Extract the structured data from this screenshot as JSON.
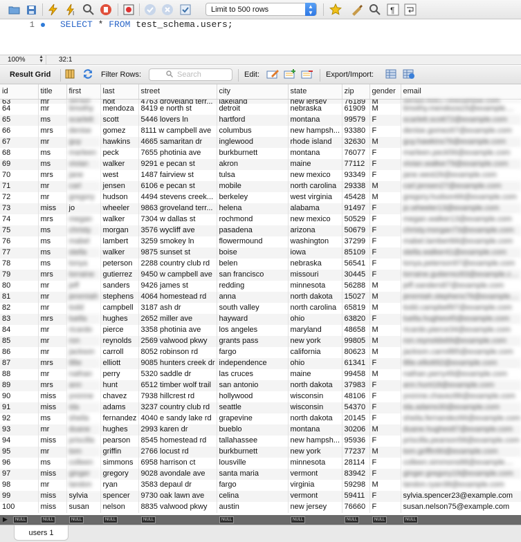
{
  "toolbar": {
    "limit_label": "Limit to 500 rows",
    "icons": [
      "open-folder-icon",
      "save-icon",
      "lightning-execute-icon",
      "lightning-execute-current-icon",
      "explain-magnifier-icon",
      "stop-icon",
      "toggle-error-icon",
      "commit-check-icon",
      "rollback-x-icon",
      "autocommit-icon",
      "bookmark-star-icon",
      "beautify-brush-icon",
      "find-icon",
      "invisible-chars-icon",
      "wrap-icon"
    ]
  },
  "editor": {
    "line_number": "1",
    "sql_select": "SELECT",
    "sql_star": " * ",
    "sql_from": "FROM",
    "sql_rest": " test_schema.users;"
  },
  "status": {
    "zoom": "100%",
    "cursor": "32:1"
  },
  "grid_toolbar": {
    "result_grid": "Result Grid",
    "filter_rows": "Filter Rows:",
    "search_placeholder": "Search",
    "edit": "Edit:",
    "export_import": "Export/Import:"
  },
  "columns": [
    "id",
    "title",
    "first",
    "last",
    "street",
    "city",
    "state",
    "zip",
    "gender",
    "email"
  ],
  "top_partial_row": [
    "63",
    "mr",
    "gerald",
    "holt",
    "4763 groveland terr...",
    "lakeland",
    "new jersey",
    "76189",
    "M",
    "gerald.holt17@example.com"
  ],
  "rows": [
    [
      "64",
      "mr",
      "timothy",
      "mendoza",
      "8419 e north st",
      "detroit",
      "nebraska",
      "61909",
      "M",
      "timothy.mendoza15@example...."
    ],
    [
      "65",
      "ms",
      "scarlett",
      "scott",
      "5446 lovers ln",
      "hartford",
      "montana",
      "99579",
      "F",
      "scarlett.scott72@example.com"
    ],
    [
      "66",
      "mrs",
      "denise",
      "gomez",
      "8111 w campbell ave",
      "columbus",
      "new hampsh...",
      "93380",
      "F",
      "denise.gomez67@example.com"
    ],
    [
      "67",
      "mr",
      "guy",
      "hawkins",
      "4665 samaritan dr",
      "inglewood",
      "rhode island",
      "32630",
      "M",
      "guy.hawkins76@example.com"
    ],
    [
      "68",
      "ms",
      "marleen",
      "peck",
      "7655 photinia ave",
      "burkburnett",
      "montana",
      "76077",
      "F",
      "marleen.peck56@example.com"
    ],
    [
      "69",
      "ms",
      "vivian",
      "walker",
      "9291 e pecan st",
      "akron",
      "maine",
      "77112",
      "F",
      "vivian.walker79@example.com"
    ],
    [
      "70",
      "mrs",
      "jane",
      "west",
      "1487 fairview st",
      "tulsa",
      "new mexico",
      "93349",
      "F",
      "jane.west26@example.com"
    ],
    [
      "71",
      "mr",
      "carl",
      "jensen",
      "6106 e pecan st",
      "mobile",
      "north carolina",
      "29338",
      "M",
      "carl.jensen27@example.com"
    ],
    [
      "72",
      "mr",
      "gregory",
      "hudson",
      "4494 stevens creek...",
      "berkeley",
      "west virginia",
      "45428",
      "M",
      "gregory.hudson66@example.com"
    ],
    [
      "73",
      "miss",
      "jo",
      "wheeler",
      "9863 groveland terr...",
      "helena",
      "alabama",
      "91497",
      "F",
      "jo.wheeler13@example.com"
    ],
    [
      "74",
      "mrs",
      "megan",
      "walker",
      "7304 w dallas st",
      "rochmond",
      "new mexico",
      "50529",
      "F",
      "megan.walker13@example.com"
    ],
    [
      "75",
      "ms",
      "christy",
      "morgan",
      "3576 wycliff ave",
      "pasadena",
      "arizona",
      "50679",
      "F",
      "christy.morgan73@example.com"
    ],
    [
      "76",
      "ms",
      "mabel",
      "lambert",
      "3259 smokey ln",
      "flowermound",
      "washington",
      "37299",
      "F",
      "mabel.lambert66@example.com"
    ],
    [
      "77",
      "ms",
      "stella",
      "walker",
      "9875 sunset st",
      "boise",
      "iowa",
      "85109",
      "F",
      "stella.walker41@example.com"
    ],
    [
      "78",
      "ms",
      "tonya",
      "peterson",
      "2288 country club rd",
      "belen",
      "nebraska",
      "56541",
      "F",
      "tonya.peterson97@example.com"
    ],
    [
      "79",
      "mrs",
      "lorraine",
      "gutierrez",
      "9450 w campbell ave",
      "san francisco",
      "missouri",
      "30445",
      "F",
      "lorraine.gutierrez83@example.com"
    ],
    [
      "80",
      "mr",
      "jeff",
      "sanders",
      "9426 james st",
      "redding",
      "minnesota",
      "56288",
      "M",
      "jeff.sanders87@example.com"
    ],
    [
      "81",
      "mr",
      "jeremiah",
      "stephens",
      "4064 homestead rd",
      "anna",
      "north dakota",
      "15027",
      "M",
      "jeremiah.stephens76@example...."
    ],
    [
      "82",
      "mr",
      "todd",
      "campbell",
      "3187 ash dr",
      "south valley",
      "north carolina",
      "65819",
      "M",
      "todd.campbell97@example.com"
    ],
    [
      "83",
      "mrs",
      "luella",
      "hughes",
      "2652 miller ave",
      "hayward",
      "ohio",
      "63820",
      "F",
      "luella.hughes45@example.com"
    ],
    [
      "84",
      "mr",
      "ricardo",
      "pierce",
      "3358 photinia ave",
      "los angeles",
      "maryland",
      "48658",
      "M",
      "ricardo.pierce34@example.com"
    ],
    [
      "85",
      "mr",
      "ron",
      "reynolds",
      "2569 valwood pkwy",
      "grants pass",
      "new york",
      "99805",
      "M",
      "ron.reynolds69@example.com"
    ],
    [
      "86",
      "mr",
      "jackson",
      "carroll",
      "8052 robinson rd",
      "fargo",
      "california",
      "80623",
      "M",
      "jackson.carroll85@example.com"
    ],
    [
      "87",
      "mrs",
      "lillie",
      "elliott",
      "9085 hunters creek dr",
      "independence",
      "ohio",
      "61341",
      "F",
      "lillie.elliott92@example.com"
    ],
    [
      "88",
      "mr",
      "nathan",
      "perry",
      "5320 saddle dr",
      "las cruces",
      "maine",
      "99458",
      "M",
      "nathan.perry49@example.com"
    ],
    [
      "89",
      "mrs",
      "ann",
      "hunt",
      "6512 timber wolf trail",
      "san antonio",
      "north dakota",
      "37983",
      "F",
      "ann.hunt18@example.com"
    ],
    [
      "90",
      "miss",
      "yvonne",
      "chavez",
      "7938 hillcrest rd",
      "hollywood",
      "wisconsin",
      "48106",
      "F",
      "yvonne.chavez86@example.com"
    ],
    [
      "91",
      "miss",
      "ida",
      "adams",
      "3237 country club rd",
      "seattle",
      "wisconsin",
      "54370",
      "F",
      "ida.adams30@example.com"
    ],
    [
      "92",
      "ms",
      "sheila",
      "fernandez",
      "4040 e sandy lake rd",
      "grapevine",
      "north dakota",
      "20145",
      "F",
      "sheila.fernandez66@example.com"
    ],
    [
      "93",
      "mr",
      "duane",
      "hughes",
      "2993 karen dr",
      "bueblo",
      "montana",
      "30206",
      "M",
      "duane.hughes87@example.com"
    ],
    [
      "94",
      "miss",
      "priscilla",
      "pearson",
      "8545 homestead rd",
      "tallahassee",
      "new hampsh...",
      "95936",
      "F",
      "priscilla.pearson58@example.com"
    ],
    [
      "95",
      "mr",
      "tom",
      "griffin",
      "2766 locust rd",
      "burkburnett",
      "new york",
      "77237",
      "M",
      "tom.griffin90@example.com"
    ],
    [
      "96",
      "ms",
      "colleen",
      "simmons",
      "6958 harrison ct",
      "lousville",
      "minnesota",
      "28114",
      "F",
      "colleen.simmons88@example...."
    ],
    [
      "97",
      "miss",
      "ginger",
      "gregory",
      "9028 avondale ave",
      "santa maria",
      "vermont",
      "83942",
      "F",
      "ginger.gregory19@example.com"
    ],
    [
      "98",
      "mr",
      "landon",
      "ryan",
      "3583 depaul dr",
      "fargo",
      "virginia",
      "59298",
      "M",
      "landon.ryan38@example.com"
    ],
    [
      "99",
      "miss",
      "sylvia",
      "spencer",
      "9730 oak lawn ave",
      "celina",
      "vermont",
      "59411",
      "F",
      "sylvia.spencer23@example.com"
    ],
    [
      "100",
      "miss",
      "susan",
      "nelson",
      "8835 valwood pkwy",
      "austin",
      "new jersey",
      "76660",
      "F",
      "susan.nelson75@example.com"
    ]
  ],
  "null_label": "NULL",
  "result_tab": "users 1"
}
